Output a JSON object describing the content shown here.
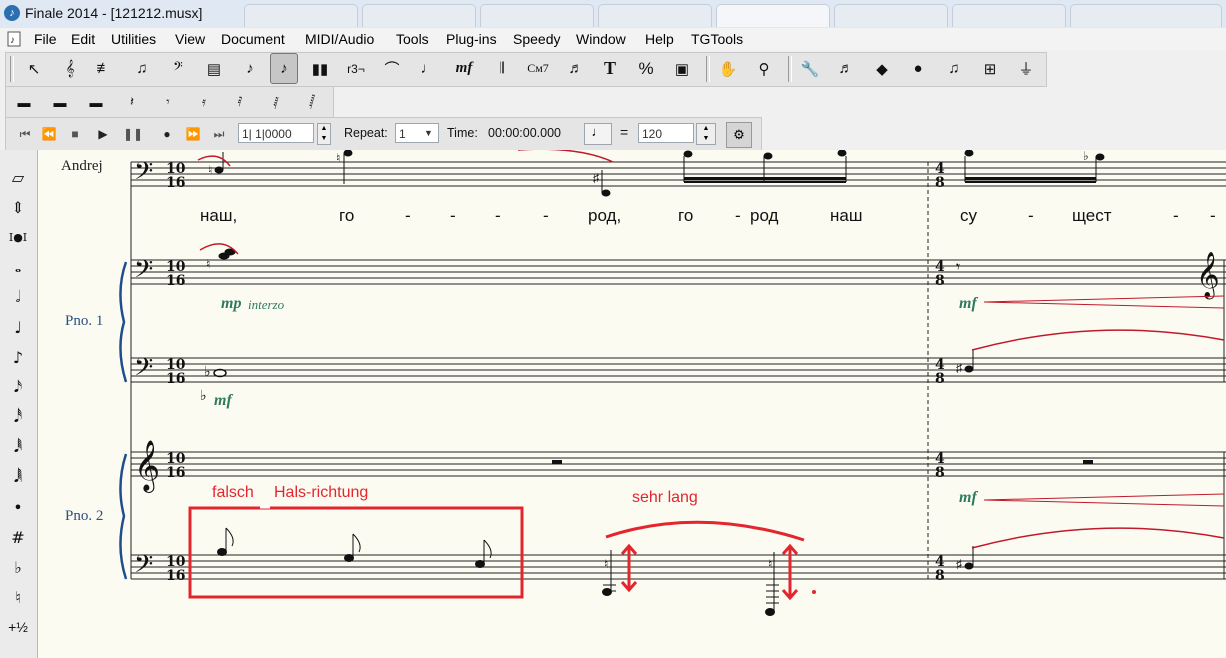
{
  "window": {
    "title": "Finale 2014 - [121212.musx]"
  },
  "menu": [
    "File",
    "Edit",
    "Utilities",
    "View",
    "Document",
    "MIDI/Audio",
    "Tools",
    "Plug-ins",
    "Speedy",
    "Window",
    "Help",
    "TGTools"
  ],
  "toolbar": {
    "buttons": [
      "selection-tool",
      "staff-tool",
      "simple-entry-tool",
      "speedy-entry-tool",
      "clef-tool",
      "time-signature-tool",
      "note-icon",
      "speedy-eighth-tool",
      "midi-tool",
      "tuplet-tool",
      "smart-shape-tool",
      "articulation-tool",
      "expression-tool",
      "repeat-tool",
      "chord-tool",
      "lyrics-tool",
      "text-tool",
      "resize-tool",
      "page-layout-tool",
      "hand-grabber-tool",
      "zoom-tool",
      "special-tools",
      "midi-audio-tool",
      "mirror-tool",
      "measure-tool",
      "ossia-tool",
      "graphics-tool",
      "metronome-tool"
    ],
    "glyphs": [
      "↖",
      "𝄞",
      "♩♪",
      "♬",
      "𝄢",
      "▤",
      "♪",
      "♪",
      "▮▮",
      "³",
      "⌒",
      "♩",
      "mf",
      "𝄂",
      "C♯7",
      "♫",
      "T",
      "%",
      "▣",
      "✋",
      "🔍",
      "🔧",
      "♬",
      "◆",
      "●",
      "♫♫",
      "⊞",
      "📐"
    ],
    "chord_label": "Cм7",
    "expression_label": "mf",
    "text_label": "T",
    "resize_label": "%",
    "tuplet_label": "r3¬"
  },
  "rests_toolbar": [
    "whole-rest",
    "half-rest",
    "quarter-rest",
    "eighth-rest",
    "sixteenth-rest",
    "thirtysecond-rest",
    "sixtyfourth-rest",
    "hundredtwentyeighth-rest"
  ],
  "playback": {
    "counter": "1| 1|0000",
    "repeat_label": "Repeat:",
    "repeat_value": "1",
    "time_label": "Time:",
    "time_value": "00:00:00.000",
    "equals": "=",
    "tempo": "120"
  },
  "palette": [
    "eraser",
    "stem-direction",
    "tie",
    "whole-note",
    "half-note",
    "quarter-note",
    "eighth-note",
    "sixteenth-note",
    "thirtysecond-note",
    "sixtyfourth-note",
    "hundredtwentyeighth-note",
    "dot",
    "sharp",
    "flat",
    "natural",
    "half-step"
  ],
  "palette_labels": {
    "dot": "•",
    "sharp": "#",
    "flat": "♭",
    "natural": "♮",
    "half_step": "+½"
  },
  "score": {
    "vocal_name": "Andrej",
    "piano1_name": "Pno. 1",
    "piano2_name": "Pno. 2",
    "time_sig_1": [
      "10",
      "16"
    ],
    "time_sig_2": [
      "4",
      "8"
    ],
    "lyrics": [
      "наш,",
      "го",
      "-",
      "-",
      "-",
      "-",
      "род,",
      "го",
      "-",
      "род",
      "наш",
      "су",
      "-",
      "щест",
      "-",
      "-"
    ],
    "dynamics": {
      "mp": "mp",
      "interzo": "interzo",
      "mf": "mf"
    }
  },
  "annotations": {
    "falsch": "falsch",
    "hals": "Hals-richtung",
    "sehr_lang": "sehr lang"
  }
}
